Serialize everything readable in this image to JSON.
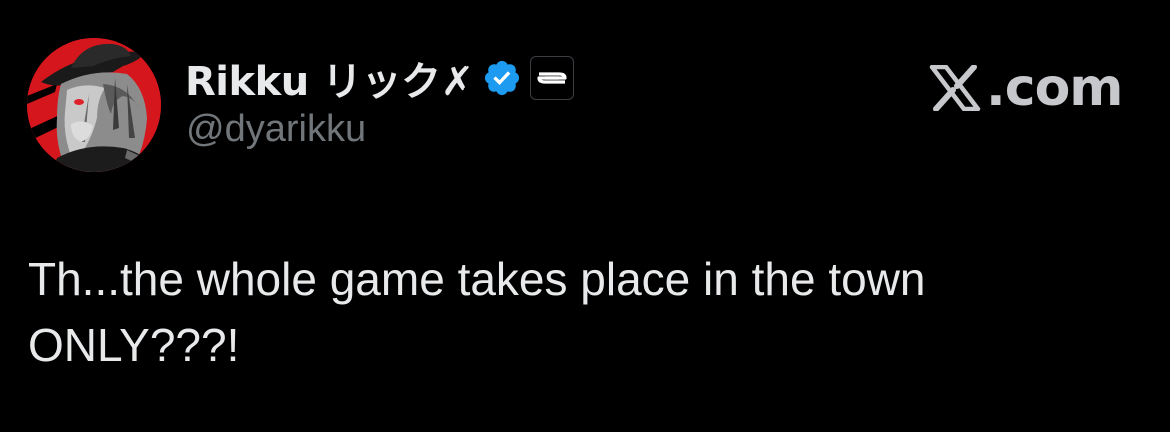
{
  "author": {
    "display_name": "Rikku リック✗",
    "handle": "@dyarikku",
    "verified": true,
    "verified_icon": "verified-badge-icon",
    "affiliate_badge_icon": "ss-affiliate-badge-icon",
    "avatar_icon": "avatar-illustration"
  },
  "brand": {
    "x_logo_icon": "x-logo-icon",
    "domain_text": ".com"
  },
  "tweet": {
    "text_line_1": "Th...the whole game takes place in the town",
    "text_line_2": "ONLY???!"
  },
  "colors": {
    "background": "#000000",
    "primary_text": "#e7e9ea",
    "secondary_text": "#71767b",
    "verified_blue": "#1d9bf0",
    "avatar_red": "#d5161c"
  }
}
